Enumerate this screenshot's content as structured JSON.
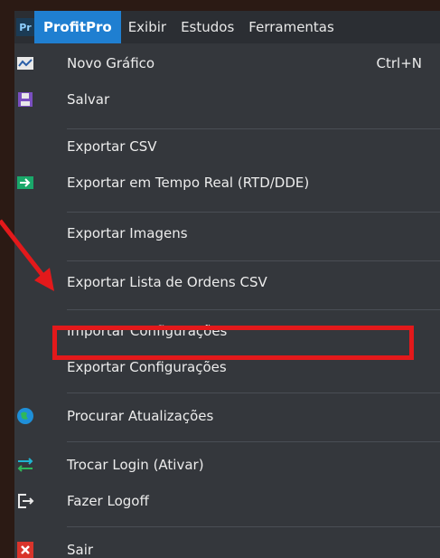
{
  "menubar": {
    "logo_text": "Pr",
    "items": [
      "ProfitPro",
      "Exibir",
      "Estudos",
      "Ferramentas"
    ]
  },
  "dropdown": {
    "items": [
      {
        "label": "Novo Gráfico",
        "shortcut": "Ctrl+N",
        "icon": "chart-icon"
      },
      {
        "label": "Salvar",
        "icon": "save-icon"
      },
      {
        "label": "Exportar CSV"
      },
      {
        "label": "Exportar em Tempo Real (RTD/DDE)",
        "icon": "export-realtime-icon"
      },
      {
        "label": "Exportar Imagens"
      },
      {
        "label": "Exportar Lista de Ordens CSV"
      },
      {
        "label": "Importar Configurações"
      },
      {
        "label": "Exportar Configurações"
      },
      {
        "label": "Procurar Atualizações",
        "icon": "globe-icon"
      },
      {
        "label": "Trocar Login (Ativar)",
        "icon": "swap-icon"
      },
      {
        "label": "Fazer Logoff",
        "icon": "logoff-icon"
      },
      {
        "label": "Sair",
        "icon": "close-icon"
      }
    ]
  },
  "colors": {
    "menu_active": "#1f7fd1",
    "annotation": "#e3191b"
  }
}
